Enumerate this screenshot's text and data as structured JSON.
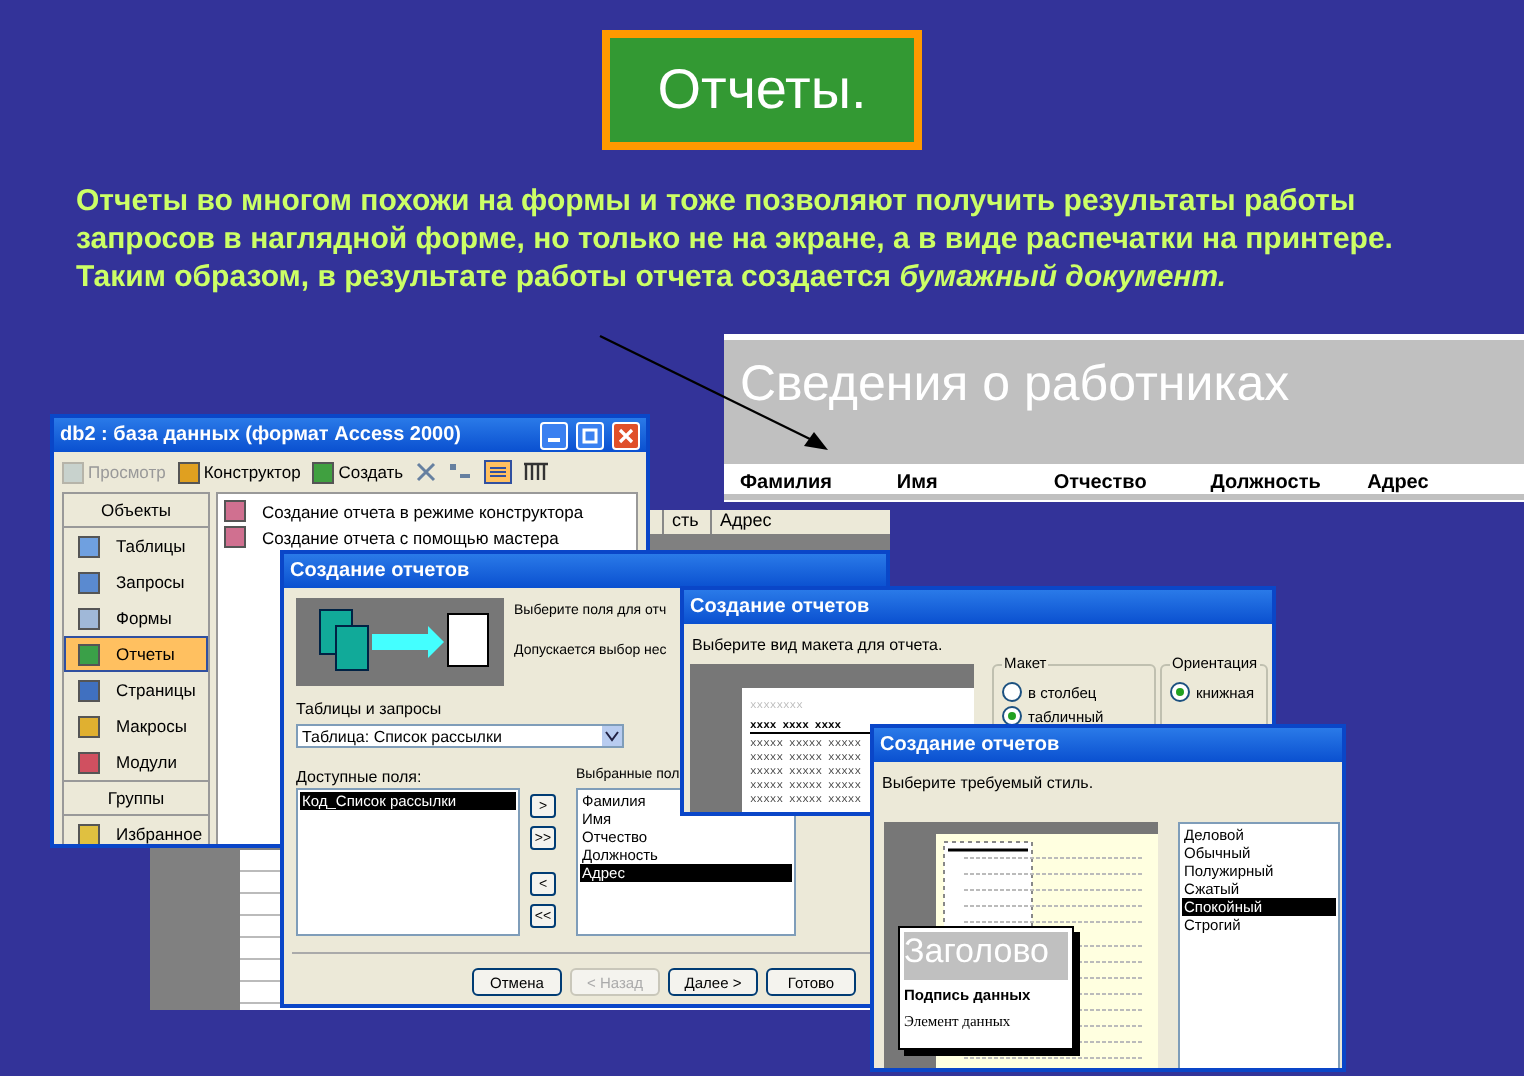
{
  "slide": {
    "title": "Отчеты.",
    "text": "Отчеты во многом похожи на формы и тоже позволяют получить результаты работы запросов в наглядной форме, но только не на экране, а в виде распечатки на принтере. Таким образом, в результате работы отчета создается *бумажный документ.*"
  },
  "report_sample": {
    "title": "Сведения о работниках",
    "columns": [
      "Фамилия",
      "Имя",
      "Отчество",
      "Должность",
      "Адрес"
    ]
  },
  "datasheet": {
    "columns": [
      "сть",
      "Адрес"
    ]
  },
  "db_window": {
    "title": "db2 : база данных (формат Access 2000)",
    "toolbar": [
      {
        "label": "Просмотр",
        "disabled": true,
        "kind": "preview"
      },
      {
        "label": "Конструктор",
        "disabled": false,
        "kind": "design"
      },
      {
        "label": "Создать",
        "disabled": false,
        "kind": "new"
      }
    ],
    "objects_header": "Объекты",
    "objects": [
      {
        "label": "Таблицы",
        "selected": false,
        "kind": "table"
      },
      {
        "label": "Запросы",
        "selected": false,
        "kind": "query"
      },
      {
        "label": "Формы",
        "selected": false,
        "kind": "form"
      },
      {
        "label": "Отчеты",
        "selected": true,
        "kind": "report"
      },
      {
        "label": "Страницы",
        "selected": false,
        "kind": "page"
      },
      {
        "label": "Макросы",
        "selected": false,
        "kind": "macro"
      },
      {
        "label": "Модули",
        "selected": false,
        "kind": "module"
      }
    ],
    "groups_header": "Группы",
    "groups": [
      {
        "label": "Избранное",
        "selected": false,
        "kind": "folder"
      }
    ],
    "items": [
      "Создание отчета в режиме конструктора",
      "Создание отчета с помощью мастера"
    ]
  },
  "wizard_fields": {
    "title": "Создание отчетов",
    "prompt": "Выберите поля для отч",
    "hint": "Допускается выбор нес",
    "source_label": "Таблицы и запросы",
    "source_value": "Таблица: Список рассылки",
    "available_label": "Доступные поля:",
    "available": [
      {
        "label": "Код_Список рассылки",
        "selected": true
      }
    ],
    "move_buttons": [
      ">",
      ">>",
      "<",
      "<<"
    ],
    "selected_label": "Выбранные пол",
    "selected_fields": [
      {
        "label": "Фамилия",
        "selected": false
      },
      {
        "label": "Имя",
        "selected": false
      },
      {
        "label": "Отчество",
        "selected": false
      },
      {
        "label": "Должность",
        "selected": false
      },
      {
        "label": "Адрес",
        "selected": true
      }
    ],
    "buttons": [
      {
        "label": "Отмена",
        "disabled": false
      },
      {
        "label": "< Назад",
        "disabled": true
      },
      {
        "label": "Далее >",
        "disabled": false
      },
      {
        "label": "Готово",
        "disabled": false
      }
    ]
  },
  "wizard_layout": {
    "title": "Создание отчетов",
    "prompt": "Выберите вид макета для отчета.",
    "preview": {
      "title": "xxxxxxxx",
      "header": [
        "xxxx",
        "xxxx",
        "xxxx"
      ],
      "rows": [
        [
          "xxxxx",
          "xxxxx",
          "xxxxx"
        ],
        [
          "xxxxx",
          "xxxxx",
          "xxxxx"
        ],
        [
          "xxxxx",
          "xxxxx",
          "xxxxx"
        ],
        [
          "xxxxx",
          "xxxxx",
          "xxxxx"
        ],
        [
          "xxxxx",
          "xxxxx",
          "xxxxx"
        ]
      ]
    },
    "layout_label": "Макет",
    "layout_options": [
      {
        "label": "в столбец",
        "selected": false
      },
      {
        "label": "табличный",
        "selected": true
      }
    ],
    "orientation_label": "Ориентация",
    "orientation_options": [
      {
        "label": "книжная",
        "selected": true
      }
    ]
  },
  "wizard_style": {
    "title": "Создание отчетов",
    "prompt": "Выберите требуемый стиль.",
    "preview": {
      "heading": "Заголово",
      "caption": "Подпись данных",
      "item": "Элемент данных"
    },
    "styles": [
      {
        "label": "Деловой",
        "selected": false
      },
      {
        "label": "Обычный",
        "selected": false
      },
      {
        "label": "Полужирный",
        "selected": false
      },
      {
        "label": "Сжатый",
        "selected": false
      },
      {
        "label": "Спокойный",
        "selected": true
      },
      {
        "label": "Строгий",
        "selected": false
      }
    ]
  }
}
